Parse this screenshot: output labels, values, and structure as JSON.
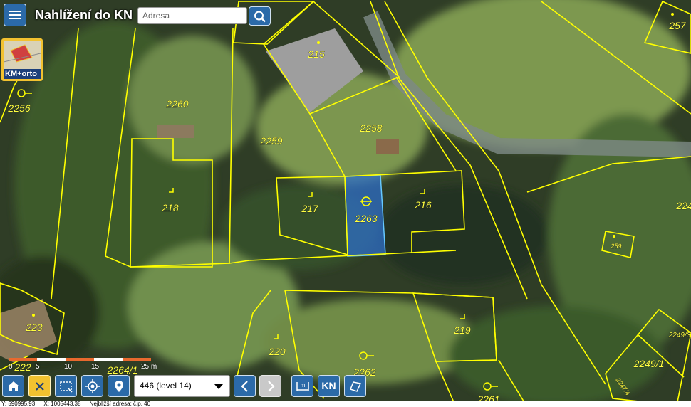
{
  "app": {
    "title": "Nahlížení do KN"
  },
  "search": {
    "placeholder": "Adresa"
  },
  "layer_switch": {
    "label": "KM+orto"
  },
  "parcels": {
    "p215": "215",
    "p257": "257",
    "p2256": "2256",
    "p2260": "2260",
    "p2259": "2259",
    "p2258": "2258",
    "p218": "218",
    "p217": "217",
    "p2263": "2263",
    "p216": "216",
    "p224": "224",
    "p259": "259",
    "p223": "223",
    "p220": "220",
    "p219": "219",
    "p2262": "2262",
    "p2249_3": "2249/3",
    "p2249_1": "2249/1",
    "p2261": "2261",
    "p2264_1": "2264/1",
    "p222": "222",
    "p2247_4": "2247/4"
  },
  "scale": {
    "l0": "0",
    "l1": "5",
    "l2": "10",
    "l3": "15",
    "l4": "25 m"
  },
  "toolbar": {
    "level_value": "446 (level 14)",
    "kn_label": "KN",
    "icons": [
      "home-icon",
      "close-icon",
      "select-area-icon",
      "locate-icon",
      "map-pin-icon",
      "chevron-left-icon",
      "chevron-right-icon",
      "measure-icon",
      "polygon-icon"
    ]
  },
  "statusbar": {
    "coords_y": "Y: 590995.93",
    "coords_x": "X: 1005443.38",
    "note": "Nejbližší adresa: č.p. 40"
  },
  "colors": {
    "parcel_line": "#ffff00",
    "parcel_label": "#ffff40",
    "selected_fill": "#2d6ec8",
    "button": "#2b6aa8",
    "accent": "#f2c230"
  }
}
